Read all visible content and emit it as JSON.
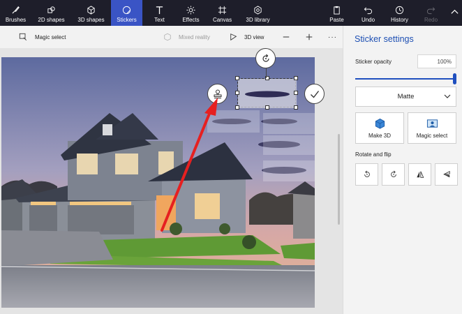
{
  "toolbar": {
    "tools": [
      {
        "label": "Brushes",
        "icon": "brush-icon"
      },
      {
        "label": "2D shapes",
        "icon": "shapes-2d-icon"
      },
      {
        "label": "3D shapes",
        "icon": "cube-icon"
      },
      {
        "label": "Stickers",
        "icon": "sticker-icon"
      },
      {
        "label": "Text",
        "icon": "text-icon"
      },
      {
        "label": "Effects",
        "icon": "sun-icon"
      },
      {
        "label": "Canvas",
        "icon": "canvas-icon"
      },
      {
        "label": "3D library",
        "icon": "library-icon"
      }
    ],
    "right_tools": [
      {
        "label": "Paste",
        "icon": "paste-icon"
      },
      {
        "label": "Undo",
        "icon": "undo-icon"
      },
      {
        "label": "History",
        "icon": "history-icon"
      },
      {
        "label": "Redo",
        "icon": "redo-icon"
      }
    ],
    "active": "Stickers",
    "accent": "#3a54c5",
    "background": "#1e1e2a"
  },
  "subbar": {
    "magic_select": "Magic select",
    "mixed_reality": "Mixed reality",
    "view_3d": "3D view",
    "zoom_in": "+",
    "more": "···"
  },
  "panel": {
    "title": "Sticker settings",
    "opacity_label": "Sticker opacity",
    "opacity_value": "100%",
    "opacity_level": 1.0,
    "finish": "Matte",
    "make3d_label": "Make 3D",
    "magic_select_label": "Magic select",
    "rotate_label": "Rotate and flip",
    "title_color": "#1d4fb3"
  }
}
